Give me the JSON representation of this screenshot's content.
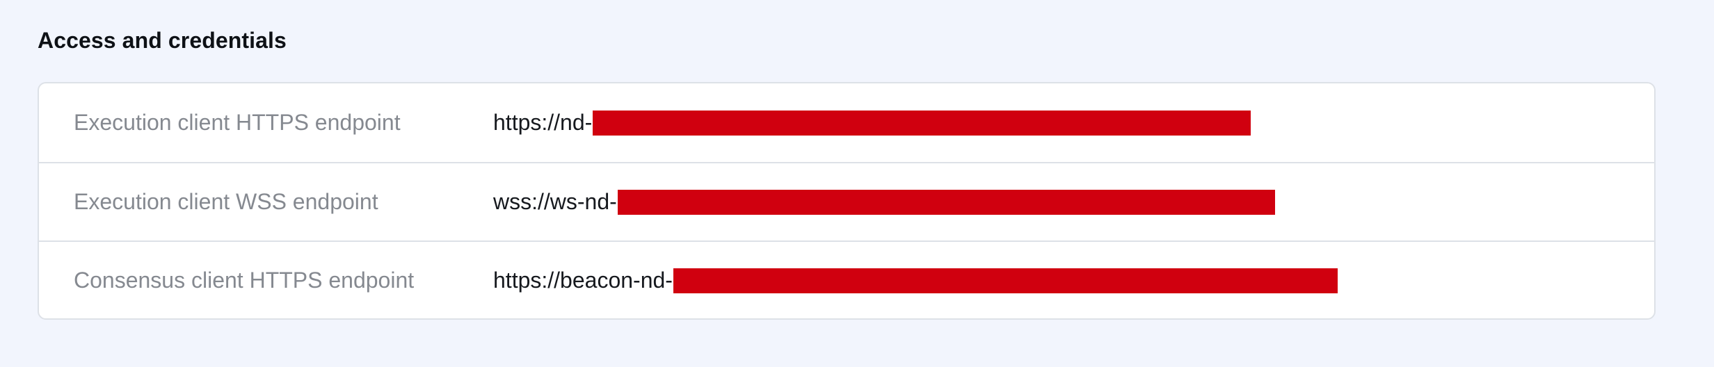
{
  "section": {
    "title": "Access and credentials"
  },
  "rows": [
    {
      "label": "Execution client HTTPS endpoint",
      "value_prefix": "https://nd-",
      "value_redacted": true
    },
    {
      "label": "Execution client WSS endpoint",
      "value_prefix": "wss://ws-nd-",
      "value_redacted": true
    },
    {
      "label": "Consensus client HTTPS endpoint",
      "value_prefix": "https://beacon-nd-",
      "value_redacted": true
    }
  ],
  "colors": {
    "page_background": "#f2f5fd",
    "card_background": "#ffffff",
    "border": "#dde1e7",
    "label_text": "#858990",
    "value_text": "#16191e",
    "redaction": "#d0000f"
  }
}
